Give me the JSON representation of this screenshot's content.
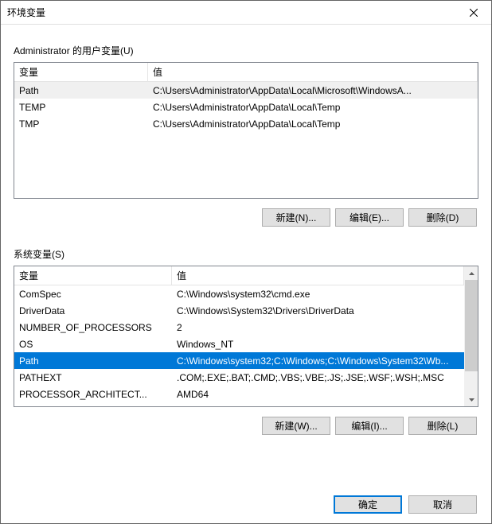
{
  "titlebar": {
    "title": "环境变量"
  },
  "user_section": {
    "label": "Administrator 的用户变量(U)",
    "col_name": "变量",
    "col_value": "值",
    "rows": [
      {
        "name": "Path",
        "value": "C:\\Users\\Administrator\\AppData\\Local\\Microsoft\\WindowsA..."
      },
      {
        "name": "TEMP",
        "value": "C:\\Users\\Administrator\\AppData\\Local\\Temp"
      },
      {
        "name": "TMP",
        "value": "C:\\Users\\Administrator\\AppData\\Local\\Temp"
      }
    ],
    "buttons": {
      "new": "新建(N)...",
      "edit": "编辑(E)...",
      "delete": "删除(D)"
    },
    "selected_index": 0
  },
  "system_section": {
    "label": "系统变量(S)",
    "col_name": "变量",
    "col_value": "值",
    "rows": [
      {
        "name": "ComSpec",
        "value": "C:\\Windows\\system32\\cmd.exe"
      },
      {
        "name": "DriverData",
        "value": "C:\\Windows\\System32\\Drivers\\DriverData"
      },
      {
        "name": "NUMBER_OF_PROCESSORS",
        "value": "2"
      },
      {
        "name": "OS",
        "value": "Windows_NT"
      },
      {
        "name": "Path",
        "value": "C:\\Windows\\system32;C:\\Windows;C:\\Windows\\System32\\Wb..."
      },
      {
        "name": "PATHEXT",
        "value": ".COM;.EXE;.BAT;.CMD;.VBS;.VBE;.JS;.JSE;.WSF;.WSH;.MSC"
      },
      {
        "name": "PROCESSOR_ARCHITECT...",
        "value": "AMD64"
      }
    ],
    "buttons": {
      "new": "新建(W)...",
      "edit": "编辑(I)...",
      "delete": "删除(L)"
    },
    "selected_index": 4
  },
  "dialog_buttons": {
    "ok": "确定",
    "cancel": "取消"
  },
  "colors": {
    "selection": "#0078d7",
    "inactive_selection": "#f0f0f0"
  }
}
